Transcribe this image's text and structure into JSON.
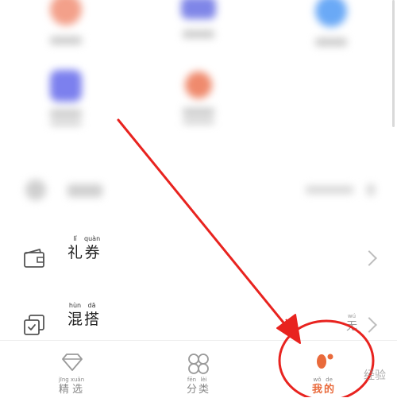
{
  "list": {
    "items": [
      {
        "pinyin": [
          "lǐ",
          "quàn"
        ],
        "chars": [
          "礼",
          "券"
        ],
        "value": null
      },
      {
        "pinyin": [
          "hùn",
          "dā"
        ],
        "chars": [
          "混",
          "搭"
        ],
        "value": {
          "pinyin": "wú",
          "char": "无"
        }
      }
    ]
  },
  "tabbar": {
    "tabs": [
      {
        "pinyin": [
          "jīng",
          "xuǎn"
        ],
        "chars": [
          "精",
          "选"
        ],
        "active": false
      },
      {
        "pinyin": [
          "fēn",
          "lèi"
        ],
        "chars": [
          "分",
          "类"
        ],
        "active": false
      },
      {
        "pinyin": [
          "wǒ",
          "de"
        ],
        "chars": [
          "我",
          "的"
        ],
        "active": true
      }
    ]
  },
  "watermark": "经验",
  "colors": {
    "accent": "#e96a3b",
    "annotation": "#e8231f",
    "icon_gray": "#9a9a9a"
  }
}
